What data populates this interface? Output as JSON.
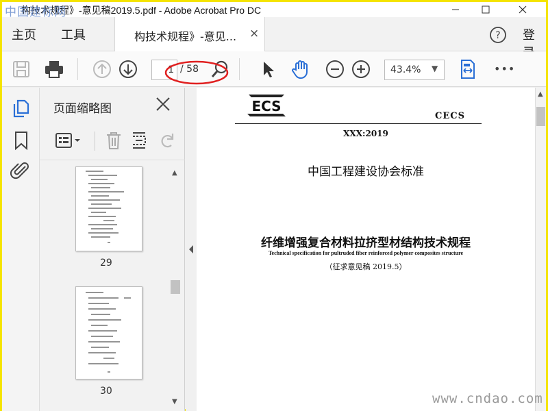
{
  "window": {
    "title": "构技术规程》-意见稿2019.5.pdf - Adobe Acrobat Pro DC",
    "watermark_top": "中国建标网",
    "watermark_bottom": "www.cndao.com"
  },
  "menubar": {
    "home": "主页",
    "tools": "工具",
    "tab_label": "构技术规程》-意见...",
    "tab_close": "×",
    "login": "登录"
  },
  "toolbar": {
    "page_current": "1",
    "page_total": "/ 58",
    "zoom": "43.4%",
    "more": "•••"
  },
  "sidebar": {
    "panel_title": "页面缩略图",
    "thumbnails": [
      {
        "page": "29"
      },
      {
        "page": "30"
      }
    ]
  },
  "document": {
    "logo": "ECS",
    "org": "CECS",
    "code": "XXX:2019",
    "standard_title": "中国工程建设协会标准",
    "title_cn": "纤维增强复合材料拉挤型材结构技术规程",
    "title_en": "Technical specification for pultruded fiber reinforced polymer composites structure",
    "edition": "（征求意见稿 2019.5）"
  },
  "colors": {
    "accent": "#2a6fd6",
    "annotation": "#e02020",
    "frame": "#f5e400"
  },
  "icons": [
    "save-icon",
    "print-icon",
    "prev-page-icon",
    "next-page-icon",
    "zoom-search-icon",
    "select-arrow-icon",
    "hand-icon",
    "zoom-out-icon",
    "zoom-in-icon",
    "fit-width-icon",
    "thumbnails-icon",
    "bookmark-icon",
    "attachment-icon",
    "options-icon",
    "delete-icon",
    "insert-page-icon",
    "rotate-icon",
    "help-icon"
  ]
}
